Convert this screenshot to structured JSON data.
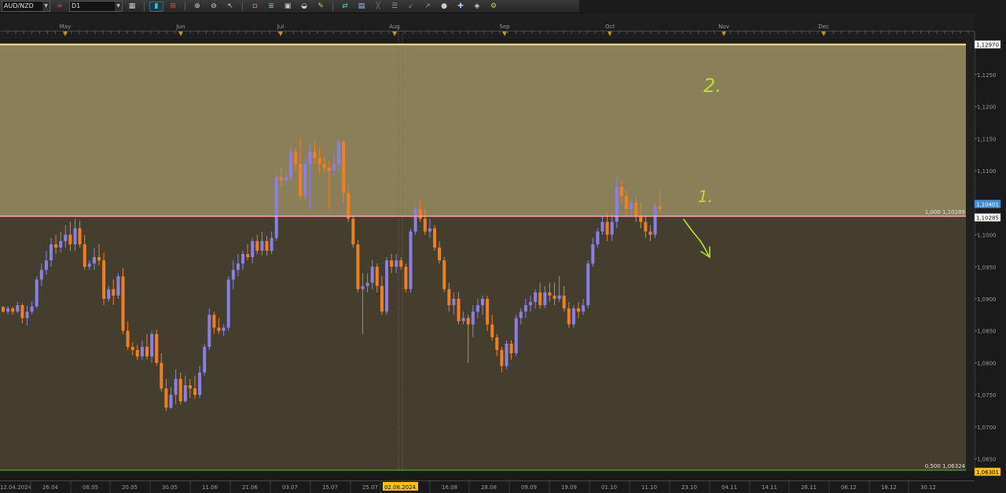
{
  "toolbar": {
    "symbol": "AUD/NZD",
    "timeframe": "D1",
    "icons": [
      "link-icon",
      "chart-type-icon",
      "candles-icon",
      "indicators-icon",
      "zoom-in-icon",
      "zoom-out-icon",
      "cursor-icon",
      "crosshair-icon",
      "fibonacci-icon",
      "screenshot-icon",
      "template-icon",
      "pencil-icon",
      "objects-icon",
      "properties-icon",
      "line-tool-icon",
      "channel-tool-icon",
      "arrow-tool-icon",
      "trend-tool-icon",
      "sphere-icon",
      "add-icon",
      "eraser-icon",
      "settings-icon"
    ]
  },
  "colors": {
    "background": "#1b1b1b",
    "zone_upper": "#8b7f5a",
    "zone_lower": "#443e2f",
    "bull_candle": "#8a7fe6",
    "bear_candle": "#f07f1e",
    "upper_line": "#f3eb9a",
    "mid_line": "#ff9fb0",
    "green_line": "#58b83a",
    "annotation": "#b8e02e",
    "bid_tag": "#3a8ee0",
    "low_tag": "#ffc400"
  },
  "top_months": [
    "May",
    "Jun",
    "Jul",
    "Aug",
    "Sep",
    "Oct",
    "Nov",
    "Dec"
  ],
  "annotations": [
    "2.",
    "1."
  ],
  "chart_data": {
    "type": "candlestick",
    "symbol": "AUD/NZD",
    "timeframe": "D1",
    "ylim": [
      1.063,
      1.1305
    ],
    "y_ticks": [
      "1,1250",
      "1,1200",
      "1,1150",
      "1,1100",
      "1,1050",
      "1,1000",
      "1,0950",
      "1,0900",
      "1,0850",
      "1,0800",
      "1,0750",
      "1,0700",
      "1,0650"
    ],
    "x_labels": [
      "12.04.2024",
      "26.04",
      "08.05",
      "20.05",
      "30.05",
      "11.06",
      "21.06",
      "03.07",
      "15.07",
      "25.07",
      "02.08.2024",
      "16.08",
      "28.08",
      "09.09",
      "19.09",
      "01.10",
      "11.10",
      "23.10",
      "04.11",
      "14.11",
      "26.11",
      "06.12",
      "18.12",
      "30.12"
    ],
    "price_tags": {
      "upper": "1,12970",
      "bid": "1,10401",
      "level": "1,10285",
      "low": "1,06301"
    },
    "levels": [
      {
        "label": "1,000 1,10289",
        "value": 1.10289
      },
      {
        "label": "0,500 1,06324",
        "value": 1.06324
      }
    ],
    "upper_zone_top": 1.1297,
    "candles": [
      [
        1.0887,
        1.088,
        1.0878,
        1.0889
      ],
      [
        1.088,
        1.0885,
        1.0876,
        1.0889
      ],
      [
        1.0885,
        1.088,
        1.0875,
        1.0888
      ],
      [
        1.088,
        1.089,
        1.0877,
        1.0895
      ],
      [
        1.089,
        1.087,
        1.0862,
        1.0893
      ],
      [
        1.087,
        1.088,
        1.0858,
        1.0889
      ],
      [
        1.088,
        1.0888,
        1.0876,
        1.0896
      ],
      [
        1.0888,
        1.093,
        1.0885,
        1.0935
      ],
      [
        1.093,
        1.0945,
        1.092,
        1.0955
      ],
      [
        1.0945,
        1.096,
        1.0938,
        1.0975
      ],
      [
        1.096,
        1.0985,
        1.095,
        1.0995
      ],
      [
        1.0985,
        1.098,
        1.097,
        1.1
      ],
      [
        1.098,
        1.099,
        1.0972,
        1.1005
      ],
      [
        1.099,
        1.1,
        1.098,
        1.1015
      ],
      [
        1.1,
        1.0985,
        1.0975,
        1.102
      ],
      [
        1.0985,
        1.101,
        1.0975,
        1.1025
      ],
      [
        1.101,
        1.0985,
        1.098,
        1.1022
      ],
      [
        1.0985,
        1.095,
        1.0945,
        1.1
      ],
      [
        1.095,
        1.0955,
        1.0945,
        1.096
      ],
      [
        1.0955,
        1.0965,
        1.0945,
        1.098
      ],
      [
        1.0965,
        1.096,
        1.0952,
        1.0985
      ],
      [
        1.096,
        1.09,
        1.089,
        1.0972
      ],
      [
        1.09,
        1.0915,
        1.0895,
        1.092
      ],
      [
        1.0915,
        1.0905,
        1.089,
        1.093
      ],
      [
        1.0905,
        1.0935,
        1.09,
        1.094
      ],
      [
        1.0935,
        1.085,
        1.0845,
        1.0948
      ],
      [
        1.085,
        1.0825,
        1.082,
        1.0865
      ],
      [
        1.0825,
        1.082,
        1.0812,
        1.0832
      ],
      [
        1.082,
        1.081,
        1.0805,
        1.0828
      ],
      [
        1.081,
        1.0825,
        1.0805,
        1.0835
      ],
      [
        1.0825,
        1.081,
        1.0805,
        1.0845
      ],
      [
        1.081,
        1.0845,
        1.08,
        1.085
      ],
      [
        1.0845,
        1.08,
        1.0795,
        1.0852
      ],
      [
        1.08,
        1.076,
        1.0755,
        1.0815
      ],
      [
        1.076,
        1.073,
        1.0725,
        1.0775
      ],
      [
        1.073,
        1.075,
        1.0728,
        1.0762
      ],
      [
        1.075,
        1.0775,
        1.0735,
        1.079
      ],
      [
        1.0775,
        1.074,
        1.0735,
        1.0785
      ],
      [
        1.074,
        1.0765,
        1.0738,
        1.078
      ],
      [
        1.0765,
        1.076,
        1.0745,
        1.0775
      ],
      [
        1.076,
        1.075,
        1.0744,
        1.078
      ],
      [
        1.075,
        1.0785,
        1.0745,
        1.0795
      ],
      [
        1.0785,
        1.0825,
        1.078,
        1.083
      ],
      [
        1.0825,
        1.0875,
        1.082,
        1.0885
      ],
      [
        1.0875,
        1.0855,
        1.0845,
        1.088
      ],
      [
        1.0855,
        1.085,
        1.0845,
        1.087
      ],
      [
        1.085,
        1.0855,
        1.0842,
        1.086
      ],
      [
        1.0855,
        1.093,
        1.085,
        1.0935
      ],
      [
        1.093,
        1.0945,
        1.0915,
        1.096
      ],
      [
        1.0945,
        1.0955,
        1.0935,
        1.097
      ],
      [
        1.0955,
        1.097,
        1.0945,
        1.0975
      ],
      [
        1.097,
        1.0965,
        1.096,
        1.0985
      ],
      [
        1.0965,
        1.099,
        1.0955,
        1.0995
      ],
      [
        1.099,
        1.0975,
        1.097,
        1.1
      ],
      [
        1.0975,
        1.099,
        1.0968,
        1.1005
      ],
      [
        1.099,
        1.0975,
        1.0968,
        1.0998
      ],
      [
        1.0975,
        1.0995,
        1.097,
        1.1005
      ],
      [
        1.0995,
        1.109,
        1.099,
        1.1095
      ],
      [
        1.109,
        1.1085,
        1.1075,
        1.1105
      ],
      [
        1.1085,
        1.109,
        1.1075,
        1.11
      ],
      [
        1.109,
        1.113,
        1.1085,
        1.114
      ],
      [
        1.113,
        1.111,
        1.11,
        1.1135
      ],
      [
        1.111,
        1.106,
        1.1055,
        1.115
      ],
      [
        1.106,
        1.111,
        1.1055,
        1.112
      ],
      [
        1.111,
        1.113,
        1.104,
        1.114
      ],
      [
        1.113,
        1.112,
        1.111,
        1.1145
      ],
      [
        1.112,
        1.111,
        1.1095,
        1.1135
      ],
      [
        1.111,
        1.1105,
        1.1098,
        1.112
      ],
      [
        1.1105,
        1.11,
        1.104,
        1.1115
      ],
      [
        1.11,
        1.111,
        1.109,
        1.1125
      ],
      [
        1.111,
        1.1145,
        1.11,
        1.115
      ],
      [
        1.1145,
        1.1065,
        1.105,
        1.1148
      ],
      [
        1.1065,
        1.1025,
        1.102,
        1.1078
      ],
      [
        1.1025,
        1.0985,
        1.098,
        1.103
      ],
      [
        1.0985,
        1.0915,
        1.091,
        1.0992
      ],
      [
        1.0915,
        1.092,
        1.0845,
        1.094
      ],
      [
        1.092,
        1.0925,
        1.091,
        1.094
      ],
      [
        1.0925,
        1.095,
        1.0915,
        1.096
      ],
      [
        1.095,
        1.092,
        1.091,
        1.0955
      ],
      [
        1.092,
        1.088,
        1.0875,
        1.0935
      ],
      [
        1.088,
        1.096,
        1.0875,
        1.0965
      ],
      [
        1.096,
        1.095,
        1.094,
        1.097
      ],
      [
        1.095,
        1.096,
        1.094,
        1.097
      ],
      [
        1.096,
        1.095,
        1.0945,
        1.0965
      ],
      [
        1.095,
        1.0915,
        1.091,
        1.0955
      ],
      [
        1.0915,
        1.1005,
        1.091,
        1.101
      ],
      [
        1.1005,
        1.104,
        1.1,
        1.1045
      ],
      [
        1.104,
        1.1025,
        1.102,
        1.1055
      ],
      [
        1.1025,
        1.1005,
        1.1,
        1.104
      ],
      [
        1.1005,
        1.101,
        1.0995,
        1.1025
      ],
      [
        1.101,
        1.098,
        1.0975,
        1.1015
      ],
      [
        1.098,
        1.096,
        1.0955,
        1.099
      ],
      [
        1.096,
        1.0915,
        1.091,
        1.0965
      ],
      [
        1.0915,
        1.089,
        1.088,
        1.0925
      ],
      [
        1.089,
        1.09,
        1.0875,
        1.091
      ],
      [
        1.09,
        1.0865,
        1.086,
        1.091
      ],
      [
        1.0865,
        1.087,
        1.086,
        1.088
      ],
      [
        1.087,
        1.086,
        1.08,
        1.0875
      ],
      [
        1.086,
        1.088,
        1.084,
        1.089
      ],
      [
        1.088,
        1.089,
        1.087,
        1.09
      ],
      [
        1.089,
        1.09,
        1.0875,
        1.0905
      ],
      [
        1.09,
        1.086,
        1.085,
        1.0905
      ],
      [
        1.086,
        1.084,
        1.0835,
        1.0875
      ],
      [
        1.084,
        1.082,
        1.081,
        1.0845
      ],
      [
        1.082,
        1.0795,
        1.0785,
        1.0825
      ],
      [
        1.0795,
        1.083,
        1.079,
        1.0835
      ],
      [
        1.083,
        1.0815,
        1.0805,
        1.0835
      ],
      [
        1.0815,
        1.087,
        1.081,
        1.0875
      ],
      [
        1.087,
        1.088,
        1.086,
        1.0885
      ],
      [
        1.088,
        1.089,
        1.087,
        1.09
      ],
      [
        1.089,
        1.0895,
        1.088,
        1.0905
      ],
      [
        1.0895,
        1.091,
        1.0885,
        1.0915
      ],
      [
        1.091,
        1.089,
        1.0885,
        1.0925
      ],
      [
        1.089,
        1.091,
        1.0885,
        1.092
      ],
      [
        1.091,
        1.0905,
        1.0895,
        1.0925
      ],
      [
        1.0905,
        1.09,
        1.089,
        1.0925
      ],
      [
        1.09,
        1.0905,
        1.0895,
        1.0935
      ],
      [
        1.0905,
        1.0885,
        1.088,
        1.092
      ],
      [
        1.0885,
        1.086,
        1.0855,
        1.0895
      ],
      [
        1.086,
        1.0885,
        1.0855,
        1.089
      ],
      [
        1.0885,
        1.088,
        1.087,
        1.0895
      ],
      [
        1.088,
        1.089,
        1.0875,
        1.09
      ],
      [
        1.089,
        1.0955,
        1.0885,
        1.096
      ],
      [
        1.0955,
        1.0985,
        1.095,
        1.0995
      ],
      [
        1.0985,
        1.1005,
        1.098,
        1.101
      ],
      [
        1.1005,
        1.102,
        1.1,
        1.103
      ],
      [
        1.102,
        1.1,
        1.099,
        1.1035
      ],
      [
        1.1,
        1.102,
        1.099,
        1.103
      ],
      [
        1.102,
        1.1075,
        1.101,
        1.109
      ],
      [
        1.1075,
        1.106,
        1.105,
        1.1085
      ],
      [
        1.106,
        1.104,
        1.103,
        1.107
      ],
      [
        1.104,
        1.105,
        1.103,
        1.1055
      ],
      [
        1.105,
        1.103,
        1.102,
        1.106
      ],
      [
        1.103,
        1.102,
        1.101,
        1.105
      ],
      [
        1.102,
        1.1005,
        1.0995,
        1.103
      ],
      [
        1.1005,
        1.1,
        1.099,
        1.1015
      ],
      [
        1.1,
        1.1045,
        1.0995,
        1.105
      ],
      [
        1.1045,
        1.104,
        1.1035,
        1.107
      ]
    ]
  }
}
